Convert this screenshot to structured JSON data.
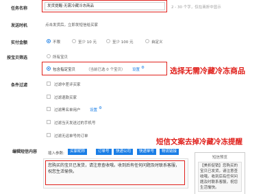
{
  "task_name": {
    "label": "任务名称",
    "value": "发货提醒-无需冷藏冷冻商品",
    "hint": "2 - 30 个字，仅在商折中显示"
  },
  "send_time": {
    "label": "发送时机",
    "value": "点击发货后，立即发短信给买家"
  },
  "pay_amount": {
    "label": "实付金额",
    "options": [
      "不限",
      "至少 10 元",
      "至少 100 元",
      "自定义"
    ]
  },
  "item_filter": {
    "label": "按宝贝筛选",
    "opt_all": "所有宝贝",
    "opt_specific": "包含指定宝贝",
    "selected_count": "（当前已选 0 个宝贝）",
    "settings": "设置"
  },
  "conditions": {
    "label": "条件过滤",
    "items": [
      "过滤中差评买家",
      "过滤退款买家",
      "过滤黑名单用户",
      "过滤当天发送过的手机号",
      "过滤无运单号的订单"
    ],
    "blacklist_settings": "设置"
  },
  "sms": {
    "label": "编辑短信内容",
    "insert_label": "插入参数:",
    "chips": [
      "买家昵称",
      "订单号",
      "快递公司",
      "快递单号",
      "物流链接"
    ],
    "content": "您购买的宝贝已发货，请注意查收哦。收到后有任何问题及时联系客服，祝您生活愉快。"
  },
  "preview": {
    "title": "短信预览",
    "text": "【美折促销】您购买的宝贝已发货，请注意查收哦。收到后有任何问题及时联系客服，祝您生活愉快。"
  },
  "annotations": {
    "a1": "选择无需冷藏冷冻商品",
    "a2": "短信文案去掉冷藏冷冻提醒"
  }
}
